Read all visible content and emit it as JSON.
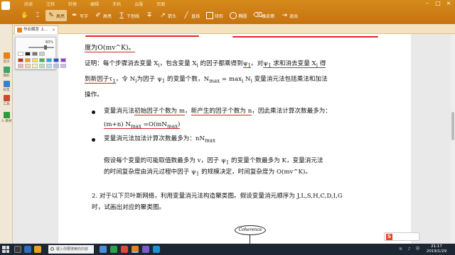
{
  "ribbon": {
    "menus": [
      "阅读",
      "注释",
      "转换",
      "编辑",
      "手机",
      "云服",
      "页面"
    ],
    "tools": [
      {
        "label": "",
        "icon": "hand-icon"
      },
      {
        "label": "",
        "icon": "select-icon"
      },
      {
        "label": "高亮",
        "icon": "highlight-icon"
      },
      {
        "label": "写字",
        "icon": "pen-icon"
      },
      {
        "label": "高亮",
        "icon": "highlight-marker-icon"
      },
      {
        "label": "下划线",
        "icon": "underline-icon"
      },
      {
        "label": "",
        "icon": "strikethrough-icon"
      },
      {
        "label": "箭头",
        "icon": "arrow-icon"
      },
      {
        "label": "直线",
        "icon": "line-icon"
      },
      {
        "label": "矩形",
        "icon": "rectangle-icon"
      },
      {
        "label": "椭圆",
        "icon": "ellipse-icon"
      },
      {
        "label": "橡皮擦",
        "icon": "eraser-icon"
      },
      {
        "label": "退出",
        "icon": "exit-icon"
      }
    ]
  },
  "tab": {
    "title": "作业解答 上..."
  },
  "sidebar": {
    "items": [
      "首页",
      "我的",
      "标签",
      "工具",
      "人·教材"
    ]
  },
  "colorpicker": {
    "opacity": "60%",
    "row1": [
      "#ffffff",
      "#222222",
      "#777777",
      "#cccccc"
    ],
    "row2": [
      "#d8241c",
      "#f2a013",
      "#f5e72c",
      "#3fb548",
      "#26a8de",
      "#2a4bd6",
      "#8e3fcf"
    ],
    "row3": [
      "#f2b4b4",
      "#f8d39c",
      "#f9f2a4",
      "#b6e3b4",
      "#b1def5",
      "#b3bff2",
      "#d3b6f0"
    ]
  },
  "doc": {
    "l1": "度为O(mv^K)。",
    "l2a": "证明：每个步骤消去变量 X",
    "l2sub": "i",
    "l2b": "，包含变量 X",
    "l2c": " 的因子都乘得到",
    "l2psi": "ψ",
    "l2d": "。对",
    "l2e": "ψ",
    "l2f": " 求和消去变量 X",
    "l2g": " 得",
    "l3a": "到新因子τ",
    "l3b": "，令 N",
    "l3c": "为因子 ψ",
    "l3d": " 的变量个数，N",
    "l3e": " = max",
    "l3f": " N",
    "l3g": "  变量消元法包括乘法和加法",
    "l4": "操作。",
    "b1a": "变量消元法",
    "b1b": "初始因子个数为 m",
    "b1c": "，",
    "b1d": "新产生的因子个数为 n",
    "b1e": "，因此乘法计算次数最多为：",
    "f1": "(m+n) N",
    "f1b": " =O(mN",
    "f1c": ")",
    "b2": "变量消元法加法计算次数最多为：nN",
    "p1": "假设每个变量的可能取值数最多为 v，因子 ψ",
    "p1b": " 的变量个数最多为 K，变量消元法",
    "p2": "的时间复杂度由消元过程中因子 ψ",
    "p2b": " 的规模决定，时间复杂度为 O(mv^K)。",
    "q2a": "2.  对于以下贝叶斯网络，利用变量消元法构造聚类图。假设变量消元顺序为 J,L,S,H,C,D,I,G",
    "q2b": "时，试画出对应的聚类图。",
    "node": "Coherence",
    "sub_max": "max",
    "sub_i": "i",
    "sub_1": "1"
  },
  "taskbar": {
    "search": "键入你要搜索的内容",
    "time": "21:17",
    "date": "2019/1/29"
  },
  "ime": {
    "label": "S"
  }
}
